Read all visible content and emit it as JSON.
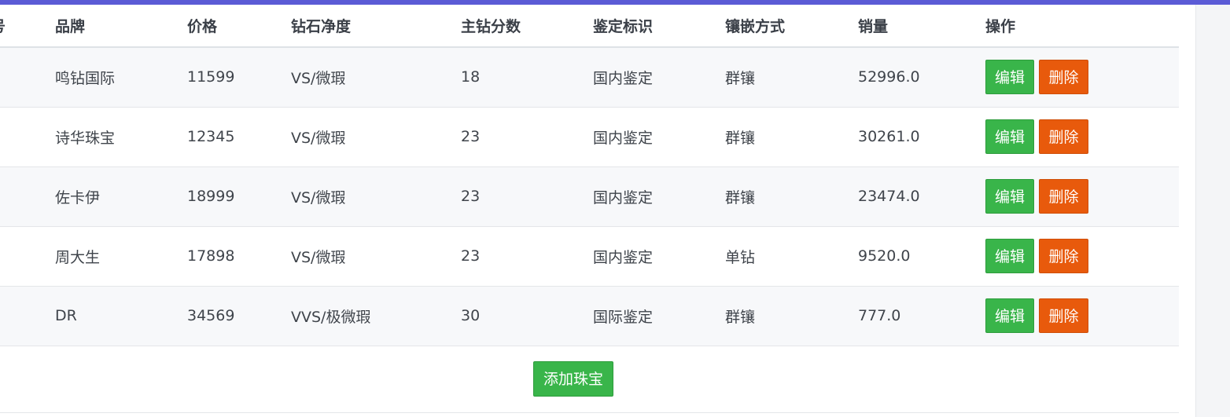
{
  "colors": {
    "accent": "#5b5bd6",
    "edit_button": "#39b54a",
    "delete_button": "#e85a0c"
  },
  "table": {
    "headers": [
      "号",
      "品牌",
      "价格",
      "钻石净度",
      "主钻分数",
      "鉴定标识",
      "镶嵌方式",
      "销量",
      "操作"
    ],
    "rows": [
      {
        "brand": "鸣钻国际",
        "price": "11599",
        "clarity": "VS/微瑕",
        "carat_points": "18",
        "certification": "国内鉴定",
        "setting": "群镶",
        "sales": "52996.0"
      },
      {
        "brand": "诗华珠宝",
        "price": "12345",
        "clarity": "VS/微瑕",
        "carat_points": "23",
        "certification": "国内鉴定",
        "setting": "群镶",
        "sales": "30261.0"
      },
      {
        "brand": "佐卡伊",
        "price": "18999",
        "clarity": "VS/微瑕",
        "carat_points": "23",
        "certification": "国内鉴定",
        "setting": "群镶",
        "sales": "23474.0"
      },
      {
        "brand": "周大生",
        "price": "17898",
        "clarity": "VS/微瑕",
        "carat_points": "23",
        "certification": "国内鉴定",
        "setting": "单钻",
        "sales": "9520.0"
      },
      {
        "brand": "DR",
        "price": "34569",
        "clarity": "VVS/极微瑕",
        "carat_points": "30",
        "certification": "国际鉴定",
        "setting": "群镶",
        "sales": "777.0"
      }
    ],
    "edit_label": "编辑",
    "delete_label": "删除"
  },
  "add_button_label": "添加珠宝"
}
